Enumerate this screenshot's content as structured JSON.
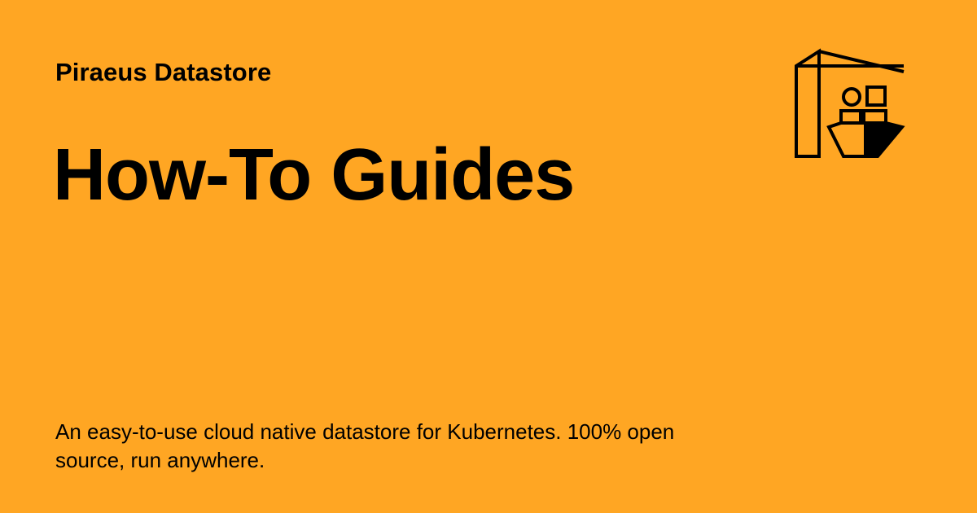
{
  "header": {
    "site_name": "Piraeus Datastore",
    "logo_icon": "crane-ship-containers-icon"
  },
  "main": {
    "title": "How-To Guides"
  },
  "footer": {
    "description": "An easy-to-use cloud native datastore for Kubernetes. 100% open source, run anywhere."
  },
  "colors": {
    "background": "#ffa623",
    "text": "#000000"
  }
}
